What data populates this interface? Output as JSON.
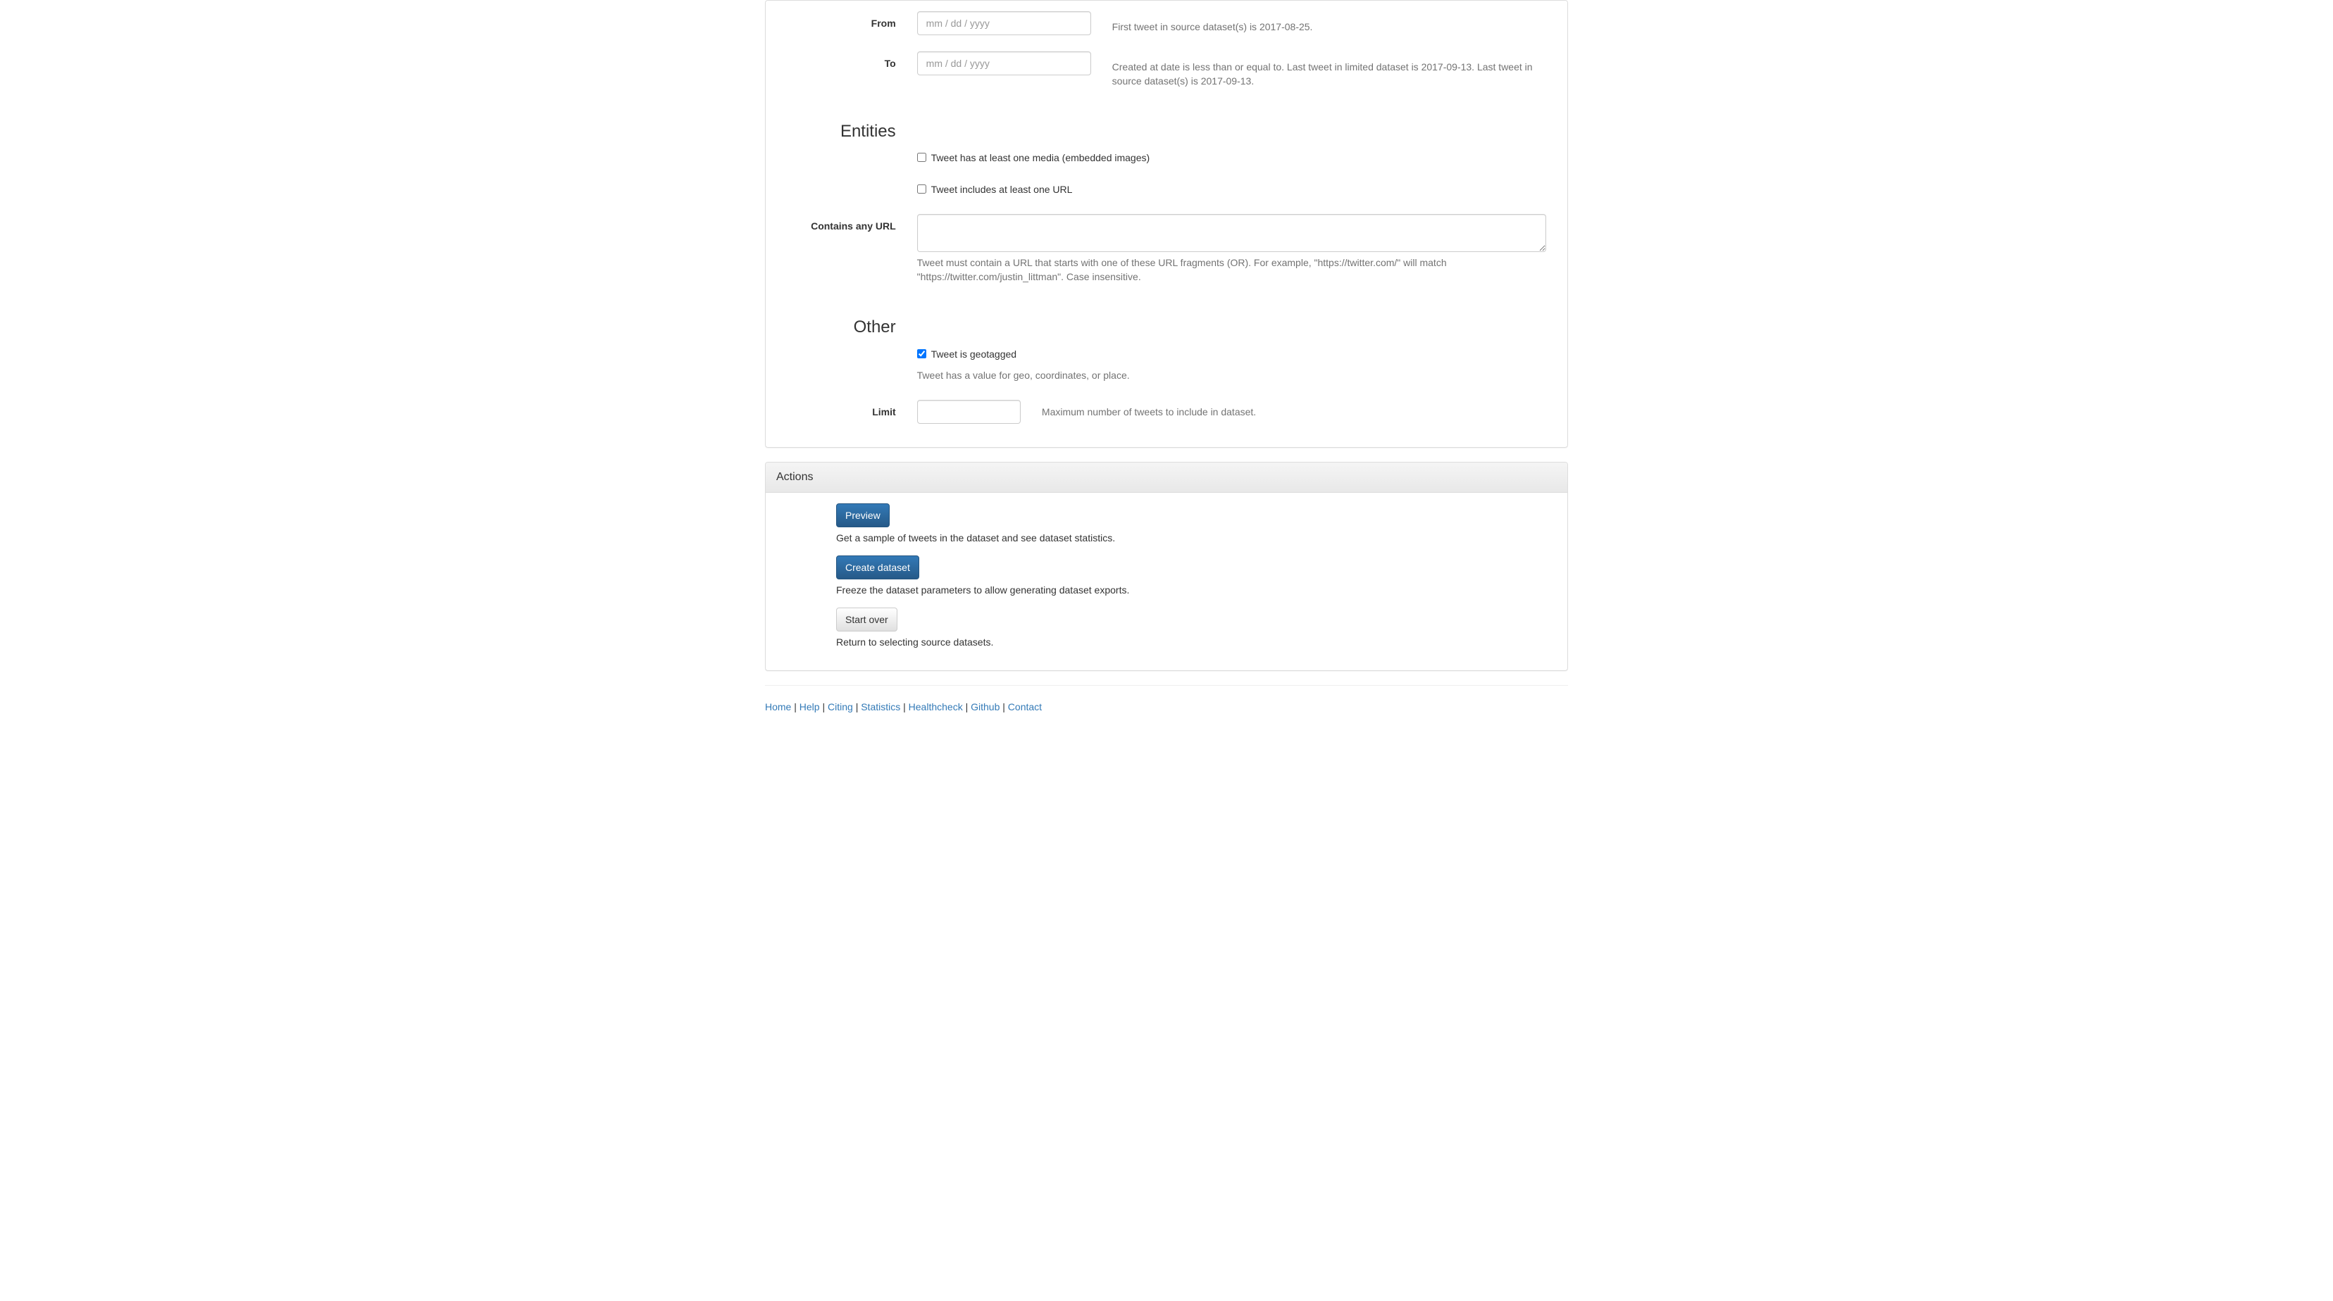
{
  "filters": {
    "from": {
      "label": "From",
      "placeholder": "mm / dd / yyyy",
      "help": "First tweet in source dataset(s) is 2017-08-25."
    },
    "to": {
      "label": "To",
      "placeholder": "mm / dd / yyyy",
      "help": "Created at date is less than or equal to. Last tweet in limited dataset is 2017-09-13. Last tweet in source dataset(s) is 2017-09-13."
    },
    "entities_heading": "Entities",
    "has_media": {
      "label": "Tweet has at least one media (embedded images)",
      "checked": false
    },
    "has_url": {
      "label": "Tweet includes at least one URL",
      "checked": false
    },
    "contains_url": {
      "label": "Contains any URL",
      "value": "",
      "help": "Tweet must contain a URL that starts with one of these URL fragments (OR). For example, \"https://twitter.com/\" will match \"https://twitter.com/justin_littman\". Case insensitive."
    },
    "other_heading": "Other",
    "geotagged": {
      "label": "Tweet is geotagged",
      "checked": true,
      "help": "Tweet has a value for geo, coordinates, or place."
    },
    "limit": {
      "label": "Limit",
      "value": "",
      "help": "Maximum number of tweets to include in dataset."
    }
  },
  "actions": {
    "heading": "Actions",
    "preview": {
      "label": "Preview",
      "desc": "Get a sample of tweets in the dataset and see dataset statistics."
    },
    "create": {
      "label": "Create dataset",
      "desc": "Freeze the dataset parameters to allow generating dataset exports."
    },
    "startover": {
      "label": "Start over",
      "desc": "Return to selecting source datasets."
    }
  },
  "footer": {
    "links": [
      "Home",
      "Help",
      "Citing",
      "Statistics",
      "Healthcheck",
      "Github",
      "Contact"
    ]
  }
}
